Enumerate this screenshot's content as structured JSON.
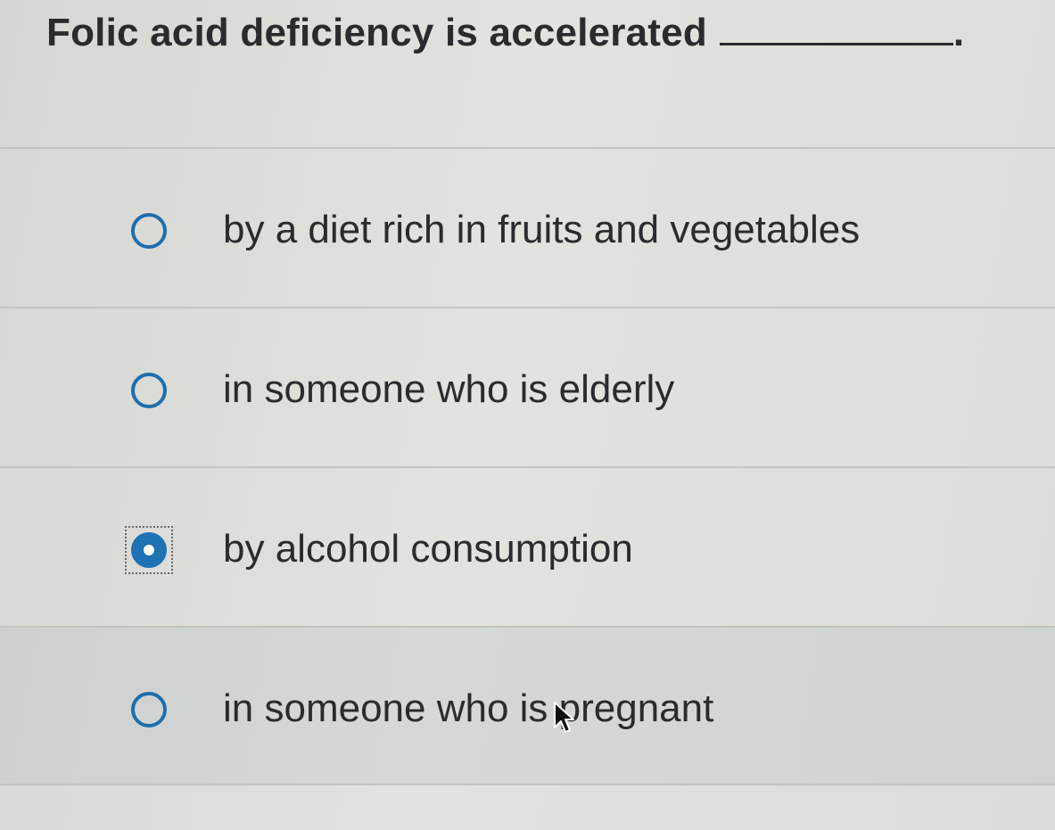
{
  "question": {
    "text": "Folic acid deficiency is accelerated",
    "trailing_punctuation": "."
  },
  "options": [
    {
      "label": "by a diet rich in fruits and vegetables",
      "selected": false
    },
    {
      "label": "in someone who is elderly",
      "selected": false
    },
    {
      "label": "by alcohol consumption",
      "selected": true
    },
    {
      "label": "in someone who is pregnant",
      "selected": false
    }
  ],
  "colors": {
    "radio_accent": "#1d73b3",
    "text": "#2b2b2e",
    "divider": "#c4c4c0"
  }
}
